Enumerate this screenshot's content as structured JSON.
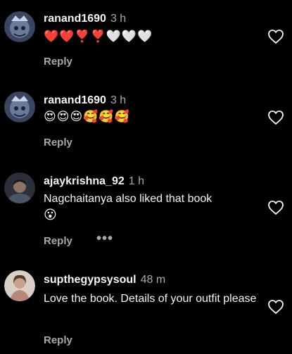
{
  "comments": [
    {
      "username": "ranand1690",
      "time": "3 h",
      "emojis": "❤️❤️❣️❣️🤍🤍🤍",
      "reply_label": "Reply"
    },
    {
      "username": "ranand1690",
      "time": "3 h",
      "emojis": "😍😍😍🥰🥰🥰",
      "reply_label": "Reply"
    },
    {
      "username": "ajaykrishna_92",
      "time": "1 h",
      "text": "Nagchaitanya also liked that book",
      "emoji": "😮",
      "reply_label": "Reply",
      "more_label": "•••"
    },
    {
      "username": "supthegypsysoul",
      "time": "48 m",
      "text": "Love the book. Details of your outfit please",
      "reply_label": "Reply"
    }
  ],
  "colors": {
    "background": "#000000",
    "primary_text": "#f5f5f5",
    "secondary_text": "#a8a8a8"
  },
  "icons": {
    "like": "heart-outline-icon",
    "more": "more-horizontal-icon"
  }
}
